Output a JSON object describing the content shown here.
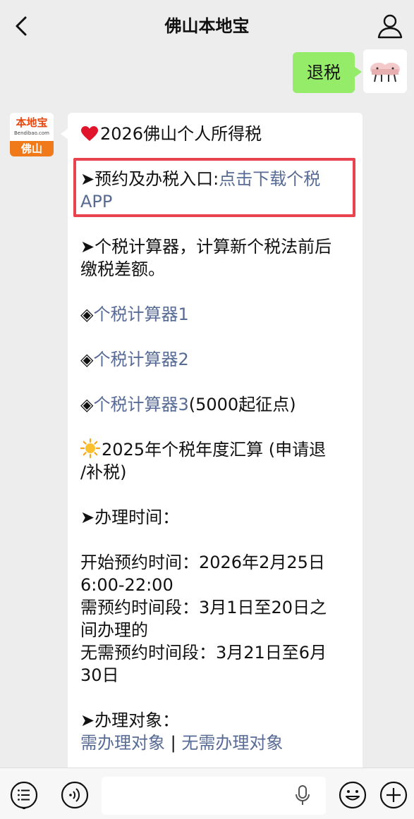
{
  "header": {
    "title": "佛山本地宝"
  },
  "outgoing_message": {
    "text": "退税"
  },
  "incoming_avatar": {
    "logo_main": "本地宝",
    "logo_sub": "Bendibao.com",
    "logo_city": "佛山"
  },
  "message": {
    "title": "2026佛山个人所得税",
    "entry_prefix": "➤预约及办税入口:",
    "entry_link_1": "点击下载个税",
    "entry_link_2": "APP",
    "calc_intro_1": "➤个税计算器，计算新个税法前后",
    "calc_intro_2": "缴税差额。",
    "calc_marker": "◈",
    "calc1": "个税计算器1",
    "calc2": "个税计算器2",
    "calc3": "个税计算器3",
    "calc3_suffix": "(5000起征点)",
    "annual_1": "2025年个税年度汇算 (申请退",
    "annual_2": "/补税)",
    "time_heading": "➤办理时间：",
    "start_1": "开始预约时间：2026年2月25日",
    "start_2": "6:00-22:00",
    "need_1": "需预约时间段：3月1日至20日之",
    "need_2": "间办理的",
    "noneed_1": "无需预约时间段：3月21日至6月",
    "noneed_2": "30日",
    "target_heading": "➤办理对象：",
    "target_link_1": "需办理对象",
    "target_sep": " | ",
    "target_link_2": "无需办理对象"
  },
  "colors": {
    "outgoing_bubble": "#95ec69",
    "link": "#576b95",
    "highlight_border": "#e8434e",
    "logo_orange": "#f07a1a"
  },
  "icons": [
    "back-icon",
    "profile-icon",
    "heart-icon",
    "sun-icon",
    "list-icon",
    "voice-icon",
    "mic-icon",
    "emoji-icon",
    "add-icon"
  ]
}
